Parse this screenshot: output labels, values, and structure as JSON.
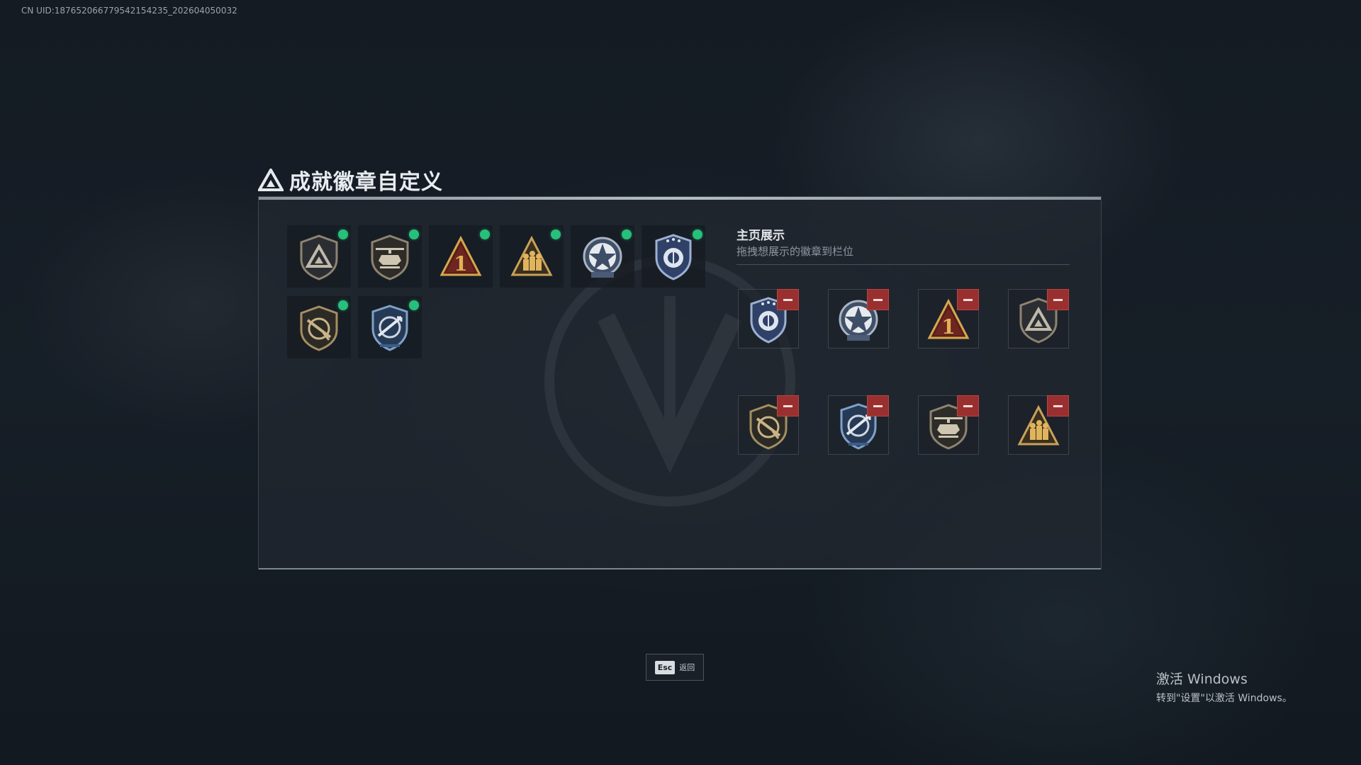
{
  "uid_text": "CN UID:187652066779542154235_202604050032",
  "title": "成就徽章自定义",
  "inventory": {
    "badges": [
      {
        "icon": "mountain-shield-badge-icon",
        "selected": true
      },
      {
        "icon": "helicopter-shield-badge-icon",
        "selected": true
      },
      {
        "icon": "number-one-triangle-badge-icon",
        "selected": true
      },
      {
        "icon": "soldiers-triangle-badge-icon",
        "selected": true
      },
      {
        "icon": "star-medal-badge-icon",
        "selected": true
      },
      {
        "icon": "eagle-shield-badge-icon",
        "selected": true
      },
      {
        "icon": "rifle-shield-badge-icon",
        "selected": true
      },
      {
        "icon": "arrows-shield-badge-icon",
        "selected": true
      }
    ]
  },
  "showcase": {
    "title": "主页展示",
    "subtitle": "拖拽想展示的徽章到栏位",
    "slots": [
      {
        "icon": "eagle-shield-badge-icon"
      },
      {
        "icon": "star-medal-badge-icon"
      },
      {
        "icon": "number-one-triangle-badge-icon"
      },
      {
        "icon": "mountain-shield-badge-icon"
      },
      {
        "icon": "rifle-shield-badge-icon"
      },
      {
        "icon": "arrows-shield-badge-icon"
      },
      {
        "icon": "helicopter-shield-badge-icon"
      },
      {
        "icon": "soldiers-triangle-badge-icon"
      }
    ]
  },
  "footer": {
    "esc_key": "Esc",
    "esc_label": "返回"
  },
  "watermark": {
    "line1": "激活 Windows",
    "line2": "转到\"设置\"以激活 Windows。"
  },
  "colors": {
    "accent_green": "#27c07a",
    "remove_red": "#9a2f2f",
    "gold": "#c9a25a"
  }
}
